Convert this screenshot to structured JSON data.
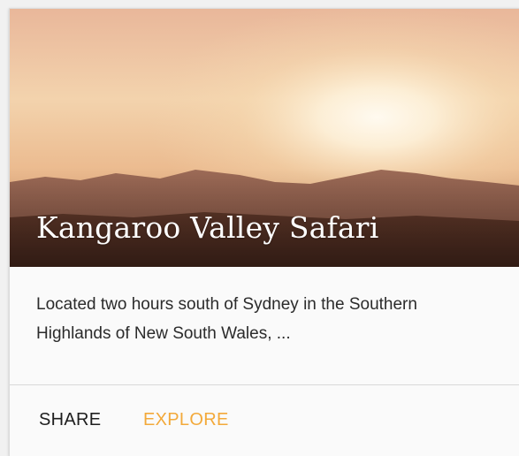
{
  "card": {
    "title": "Kangaroo Valley Safari",
    "supporting_text": "Located two hours south of Sydney in the Southern Highlands of New South Wales, ...",
    "actions": {
      "share_label": "SHARE",
      "explore_label": "EXPLORE"
    },
    "colors": {
      "primary_action": "#1e1e1e",
      "accent_action": "#f3a93a",
      "card_background": "#fafafa"
    }
  }
}
